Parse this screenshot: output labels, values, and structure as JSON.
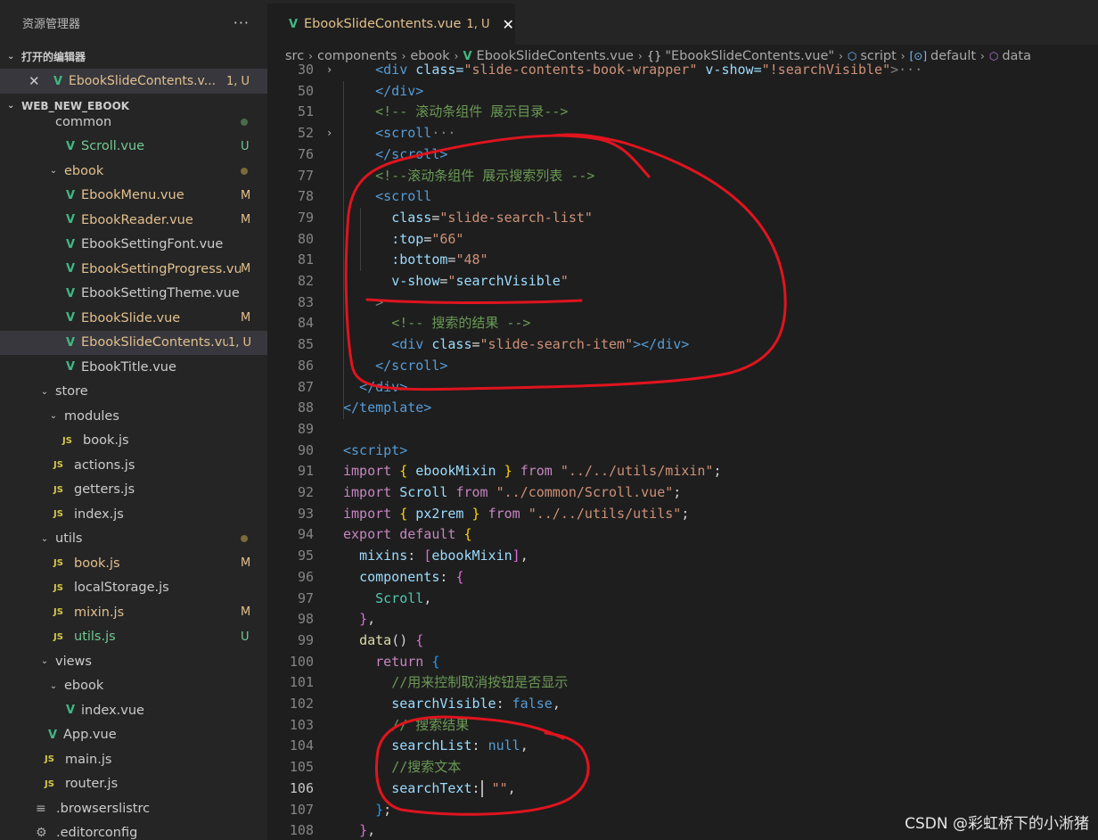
{
  "sidebar": {
    "title": "资源管理器",
    "more": "···",
    "open_editors_header": "打开的编辑器",
    "open_editor": {
      "name": "EbookSlideContents.v...",
      "badge": "1, U"
    },
    "workspace_header": "WEB_NEW_EBOOK",
    "tree": [
      {
        "name": "common",
        "icon": "folder",
        "indent": 1,
        "chevron": "",
        "status": "def",
        "badge": "",
        "dot": "green",
        "partial": true
      },
      {
        "name": "Scroll.vue",
        "icon": "vue",
        "indent": 3,
        "status": "unt",
        "badge": "U"
      },
      {
        "name": "ebook",
        "icon": "folder",
        "indent": 2,
        "chevron": "⌄",
        "status": "mod",
        "badge": "",
        "dot": "yellow"
      },
      {
        "name": "EbookMenu.vue",
        "icon": "vue",
        "indent": 3,
        "status": "mod",
        "badge": "M"
      },
      {
        "name": "EbookReader.vue",
        "icon": "vue",
        "indent": 3,
        "status": "mod",
        "badge": "M"
      },
      {
        "name": "EbookSettingFont.vue",
        "icon": "vue",
        "indent": 3,
        "status": "def",
        "badge": ""
      },
      {
        "name": "EbookSettingProgress.vue",
        "icon": "vue",
        "indent": 3,
        "status": "mod",
        "badge": "M"
      },
      {
        "name": "EbookSettingTheme.vue",
        "icon": "vue",
        "indent": 3,
        "status": "def",
        "badge": ""
      },
      {
        "name": "EbookSlide.vue",
        "icon": "vue",
        "indent": 3,
        "status": "mod",
        "badge": "M"
      },
      {
        "name": "EbookSlideContents.vue",
        "icon": "vue",
        "indent": 3,
        "status": "mod",
        "badge": "1, U",
        "active": true
      },
      {
        "name": "EbookTitle.vue",
        "icon": "vue",
        "indent": 3,
        "status": "def",
        "badge": ""
      },
      {
        "name": "store",
        "icon": "folder",
        "indent": 1,
        "chevron": "⌄",
        "status": "def",
        "badge": ""
      },
      {
        "name": "modules",
        "icon": "folder",
        "indent": 2,
        "chevron": "⌄",
        "status": "def",
        "badge": ""
      },
      {
        "name": "book.js",
        "icon": "js",
        "indent": 3,
        "status": "def",
        "badge": ""
      },
      {
        "name": "actions.js",
        "icon": "js",
        "indent": 2,
        "status": "def",
        "badge": ""
      },
      {
        "name": "getters.js",
        "icon": "js",
        "indent": 2,
        "status": "def",
        "badge": ""
      },
      {
        "name": "index.js",
        "icon": "js",
        "indent": 2,
        "status": "def",
        "badge": ""
      },
      {
        "name": "utils",
        "icon": "folder",
        "indent": 1,
        "chevron": "⌄",
        "status": "def",
        "badge": "",
        "dot": "yellow"
      },
      {
        "name": "book.js",
        "icon": "js",
        "indent": 2,
        "status": "mod",
        "badge": "M"
      },
      {
        "name": "localStorage.js",
        "icon": "js",
        "indent": 2,
        "status": "def",
        "badge": ""
      },
      {
        "name": "mixin.js",
        "icon": "js",
        "indent": 2,
        "status": "mod",
        "badge": "M"
      },
      {
        "name": "utils.js",
        "icon": "js",
        "indent": 2,
        "status": "unt",
        "badge": "U"
      },
      {
        "name": "views",
        "icon": "folder",
        "indent": 1,
        "chevron": "⌄",
        "status": "def",
        "badge": ""
      },
      {
        "name": "ebook",
        "icon": "folder",
        "indent": 2,
        "chevron": "⌄",
        "status": "def",
        "badge": ""
      },
      {
        "name": "index.vue",
        "icon": "vue",
        "indent": 3,
        "status": "def",
        "badge": ""
      },
      {
        "name": "App.vue",
        "icon": "vue",
        "indent": 1,
        "status": "def",
        "badge": ""
      },
      {
        "name": "main.js",
        "icon": "js",
        "indent": 1,
        "status": "def",
        "badge": ""
      },
      {
        "name": "router.js",
        "icon": "js",
        "indent": 1,
        "status": "def",
        "badge": ""
      },
      {
        "name": ".browserslistrc",
        "icon": "txt",
        "indent": 0,
        "status": "def",
        "badge": ""
      },
      {
        "name": ".editorconfig",
        "icon": "gear",
        "indent": 0,
        "status": "def",
        "badge": ""
      }
    ]
  },
  "tab": {
    "name": "EbookSlideContents.vue",
    "badge": "1, U",
    "close": "✕"
  },
  "breadcrumb": {
    "src": "src",
    "components": "components",
    "ebook": "ebook",
    "file": "EbookSlideContents.vue",
    "obj": "\"EbookSlideContents.vue\"",
    "script": "script",
    "default": "default",
    "data": "data"
  },
  "code": [
    {
      "n": "30",
      "fold": "›",
      "tokens": [
        [
          "    ",
          "def"
        ],
        [
          "<div ",
          "tag"
        ],
        [
          "class=",
          "attr"
        ],
        [
          "\"slide-contents-book-wrapper\"",
          "str"
        ],
        [
          " v-show=",
          "attr"
        ],
        [
          "\"!searchVisible\"",
          "str"
        ],
        [
          ">",
          "gray"
        ],
        [
          "···",
          "gray"
        ]
      ],
      "partial": true
    },
    {
      "n": "50",
      "tokens": [
        [
          "    ",
          "def"
        ],
        [
          "</div>",
          "tag"
        ]
      ]
    },
    {
      "n": "51",
      "tokens": [
        [
          "    ",
          "def"
        ],
        [
          "<!-- 滚动条组件 展示目录-->",
          "com"
        ]
      ]
    },
    {
      "n": "52",
      "fold": "›",
      "tokens": [
        [
          "    ",
          "def"
        ],
        [
          "<scroll",
          "tag"
        ],
        [
          "···",
          "gray"
        ]
      ]
    },
    {
      "n": "76",
      "tokens": [
        [
          "    ",
          "def"
        ],
        [
          "</scroll>",
          "tag"
        ]
      ]
    },
    {
      "n": "77",
      "tokens": [
        [
          "    ",
          "def"
        ],
        [
          "<!--滚动条组件 展示搜索列表 -->",
          "com"
        ]
      ]
    },
    {
      "n": "78",
      "tokens": [
        [
          "    ",
          "def"
        ],
        [
          "<scroll",
          "tag"
        ]
      ]
    },
    {
      "n": "79",
      "tokens": [
        [
          "      ",
          "def"
        ],
        [
          "class",
          "attr"
        ],
        [
          "=",
          "eq"
        ],
        [
          "\"slide-search-list\"",
          "str"
        ]
      ]
    },
    {
      "n": "80",
      "tokens": [
        [
          "      ",
          "def"
        ],
        [
          ":top",
          "attr"
        ],
        [
          "=",
          "eq"
        ],
        [
          "\"66\"",
          "str"
        ]
      ]
    },
    {
      "n": "81",
      "tokens": [
        [
          "      ",
          "def"
        ],
        [
          ":bottom",
          "attr"
        ],
        [
          "=",
          "eq"
        ],
        [
          "\"48\"",
          "str"
        ]
      ]
    },
    {
      "n": "82",
      "tokens": [
        [
          "      ",
          "def"
        ],
        [
          "v-show",
          "attr"
        ],
        [
          "=",
          "eq"
        ],
        [
          "\"",
          "str"
        ],
        [
          "searchVisible",
          "var"
        ],
        [
          "\"",
          "str"
        ]
      ]
    },
    {
      "n": "83",
      "tokens": [
        [
          "    ",
          "def"
        ],
        [
          ">",
          "gray"
        ]
      ]
    },
    {
      "n": "84",
      "tokens": [
        [
          "      ",
          "def"
        ],
        [
          "<!-- 搜索的结果 -->",
          "com"
        ]
      ]
    },
    {
      "n": "85",
      "tokens": [
        [
          "      ",
          "def"
        ],
        [
          "<div ",
          "tag"
        ],
        [
          "class",
          "attr"
        ],
        [
          "=",
          "eq"
        ],
        [
          "\"slide-search-item\"",
          "str"
        ],
        [
          "></div>",
          "tag"
        ]
      ]
    },
    {
      "n": "86",
      "tokens": [
        [
          "    ",
          "def"
        ],
        [
          "</scroll>",
          "tag"
        ]
      ]
    },
    {
      "n": "87",
      "tokens": [
        [
          "  ",
          "def"
        ],
        [
          "</div>",
          "tag"
        ]
      ]
    },
    {
      "n": "88",
      "tokens": [
        [
          "</template>",
          "tag"
        ]
      ]
    },
    {
      "n": "89",
      "tokens": []
    },
    {
      "n": "90",
      "tokens": [
        [
          "<script>",
          "tag"
        ]
      ]
    },
    {
      "n": "91",
      "tokens": [
        [
          "import ",
          "kw"
        ],
        [
          "{ ",
          "br1"
        ],
        [
          "ebookMixin",
          "var"
        ],
        [
          " } ",
          "br1"
        ],
        [
          "from ",
          "kw"
        ],
        [
          "\"../../utils/mixin\"",
          "str"
        ],
        [
          ";",
          "def"
        ]
      ]
    },
    {
      "n": "92",
      "tokens": [
        [
          "import ",
          "kw"
        ],
        [
          "Scroll ",
          "var"
        ],
        [
          "from ",
          "kw"
        ],
        [
          "\"../common/Scroll.vue\"",
          "str"
        ],
        [
          ";",
          "def"
        ]
      ]
    },
    {
      "n": "93",
      "tokens": [
        [
          "import ",
          "kw"
        ],
        [
          "{ ",
          "br1"
        ],
        [
          "px2rem",
          "var"
        ],
        [
          " } ",
          "br1"
        ],
        [
          "from ",
          "kw"
        ],
        [
          "\"../../utils/utils\"",
          "str"
        ],
        [
          ";",
          "def"
        ]
      ]
    },
    {
      "n": "94",
      "tokens": [
        [
          "export ",
          "kw"
        ],
        [
          "default ",
          "kw"
        ],
        [
          "{",
          "br1"
        ]
      ]
    },
    {
      "n": "95",
      "tokens": [
        [
          "  ",
          "def"
        ],
        [
          "mixins",
          "var"
        ],
        [
          ": ",
          "def"
        ],
        [
          "[",
          "br2"
        ],
        [
          "ebookMixin",
          "var"
        ],
        [
          "]",
          "br2"
        ],
        [
          ",",
          "def"
        ]
      ]
    },
    {
      "n": "96",
      "tokens": [
        [
          "  ",
          "def"
        ],
        [
          "components",
          "var"
        ],
        [
          ": ",
          "def"
        ],
        [
          "{",
          "br2"
        ]
      ]
    },
    {
      "n": "97",
      "tokens": [
        [
          "    ",
          "def"
        ],
        [
          "Scroll",
          "cls"
        ],
        [
          ",",
          "def"
        ]
      ]
    },
    {
      "n": "98",
      "tokens": [
        [
          "  ",
          "def"
        ],
        [
          "}",
          "br2"
        ],
        [
          ",",
          "def"
        ]
      ]
    },
    {
      "n": "99",
      "tokens": [
        [
          "  ",
          "def"
        ],
        [
          "data",
          "fn"
        ],
        [
          "() ",
          "def"
        ],
        [
          "{",
          "br2"
        ]
      ]
    },
    {
      "n": "100",
      "tokens": [
        [
          "    ",
          "def"
        ],
        [
          "return ",
          "kw"
        ],
        [
          "{",
          "br3"
        ]
      ]
    },
    {
      "n": "101",
      "tokens": [
        [
          "      ",
          "def"
        ],
        [
          "//用来控制取消按钮是否显示",
          "com"
        ]
      ]
    },
    {
      "n": "102",
      "tokens": [
        [
          "      ",
          "def"
        ],
        [
          "searchVisible",
          "var"
        ],
        [
          ": ",
          "def"
        ],
        [
          "false",
          "blue"
        ],
        [
          ",",
          "def"
        ]
      ]
    },
    {
      "n": "103",
      "tokens": [
        [
          "      ",
          "def"
        ],
        [
          "// 搜索结果",
          "com"
        ]
      ]
    },
    {
      "n": "104",
      "tokens": [
        [
          "      ",
          "def"
        ],
        [
          "searchList",
          "var"
        ],
        [
          ": ",
          "def"
        ],
        [
          "null",
          "blue"
        ],
        [
          ",",
          "def"
        ]
      ]
    },
    {
      "n": "105",
      "tokens": [
        [
          "      ",
          "def"
        ],
        [
          "//搜索文本",
          "com"
        ]
      ]
    },
    {
      "n": "106",
      "cur": true,
      "tokens": [
        [
          "      ",
          "def"
        ],
        [
          "searchText",
          "var"
        ],
        [
          ":",
          "def"
        ],
        [
          "|CURSOR|",
          "cursor"
        ],
        [
          " ",
          "def"
        ],
        [
          "\"\"",
          "str"
        ],
        [
          ",",
          "def"
        ]
      ]
    },
    {
      "n": "107",
      "tokens": [
        [
          "    ",
          "def"
        ],
        [
          "}",
          "br3"
        ],
        [
          ";",
          "def"
        ]
      ]
    },
    {
      "n": "108",
      "tokens": [
        [
          "  ",
          "def"
        ],
        [
          "}",
          "br2"
        ],
        [
          ",",
          "def"
        ]
      ]
    }
  ],
  "watermark": "CSDN @彩虹桥下的小淅猪",
  "annotation_color": "#e0141e"
}
